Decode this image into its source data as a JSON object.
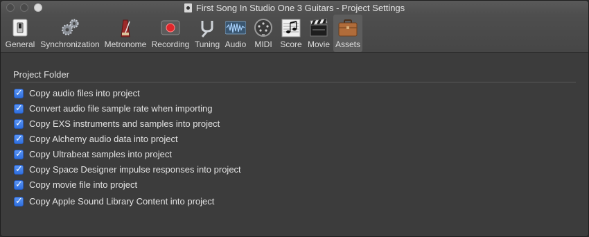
{
  "window": {
    "title": "First Song In Studio One 3 Guitars - Project Settings"
  },
  "toolbar": {
    "items": [
      {
        "label": "General",
        "icon": "switch-icon"
      },
      {
        "label": "Synchronization",
        "icon": "gears-icon"
      },
      {
        "label": "Metronome",
        "icon": "metronome-icon"
      },
      {
        "label": "Recording",
        "icon": "record-icon"
      },
      {
        "label": "Tuning",
        "icon": "tuning-fork-icon"
      },
      {
        "label": "Audio",
        "icon": "waveform-icon"
      },
      {
        "label": "MIDI",
        "icon": "midi-port-icon"
      },
      {
        "label": "Score",
        "icon": "score-notes-icon"
      },
      {
        "label": "Movie",
        "icon": "clapperboard-icon"
      },
      {
        "label": "Assets",
        "icon": "suitcase-icon"
      }
    ],
    "selected": "Assets"
  },
  "assets": {
    "section_title": "Project Folder",
    "options": [
      {
        "label": "Copy audio files into project",
        "checked": true
      },
      {
        "label": "Convert audio file sample rate when importing",
        "checked": true
      },
      {
        "label": "Copy EXS instruments and samples into project",
        "checked": true
      },
      {
        "label": "Copy Alchemy audio data into project",
        "checked": true
      },
      {
        "label": "Copy Ultrabeat samples into project",
        "checked": true
      },
      {
        "label": "Copy Space Designer impulse responses into project",
        "checked": true
      },
      {
        "label": "Copy movie file into project",
        "checked": true
      },
      {
        "label": "Copy Apple Sound Library Content into project",
        "checked": true
      }
    ]
  },
  "colors": {
    "background": "#3c3c3c",
    "checkbox_accent": "#3a7cf0",
    "text": "#e2e2e2"
  }
}
